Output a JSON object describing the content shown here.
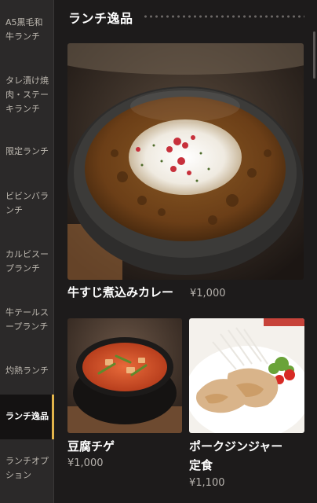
{
  "sidebar": {
    "items": [
      {
        "label_lines": [
          "A5黒毛和",
          "牛ランチ"
        ]
      },
      {
        "label_lines": [
          "タレ漬け焼",
          "肉・ステー",
          "キランチ"
        ]
      },
      {
        "label_lines": [
          "限定ランチ"
        ]
      },
      {
        "label_lines": [
          "ビビンバラ",
          "ンチ"
        ]
      },
      {
        "label_lines": [
          "カルビスー",
          "プランチ"
        ]
      },
      {
        "label_lines": [
          "牛テールス",
          "ープランチ"
        ]
      },
      {
        "label_lines": [
          "灼熱ランチ"
        ]
      },
      {
        "label_lines": [
          "ランチ逸品"
        ]
      },
      {
        "label_lines": [
          "ランチオプ",
          "ション"
        ]
      }
    ],
    "active_index": 7
  },
  "main": {
    "section_title": "ランチ逸品",
    "items": [
      {
        "name_lines": [
          "牛すじ煮込みカレー"
        ],
        "price": "¥1,000",
        "photo_icon": "beef-curry-stone-bowl"
      },
      {
        "name_lines": [
          "豆腐チゲ"
        ],
        "price": "¥1,000",
        "photo_icon": "tofu-jjigae-pot"
      },
      {
        "name_lines": [
          "ポークジンジャー",
          "定食"
        ],
        "price": "¥1,100",
        "photo_icon": "pork-ginger-plate"
      }
    ]
  },
  "colors": {
    "accent": "#e2b44b",
    "sidebar_bg": "#2b2929",
    "active_bg": "#141212",
    "page_bg": "#1d1b1b"
  }
}
